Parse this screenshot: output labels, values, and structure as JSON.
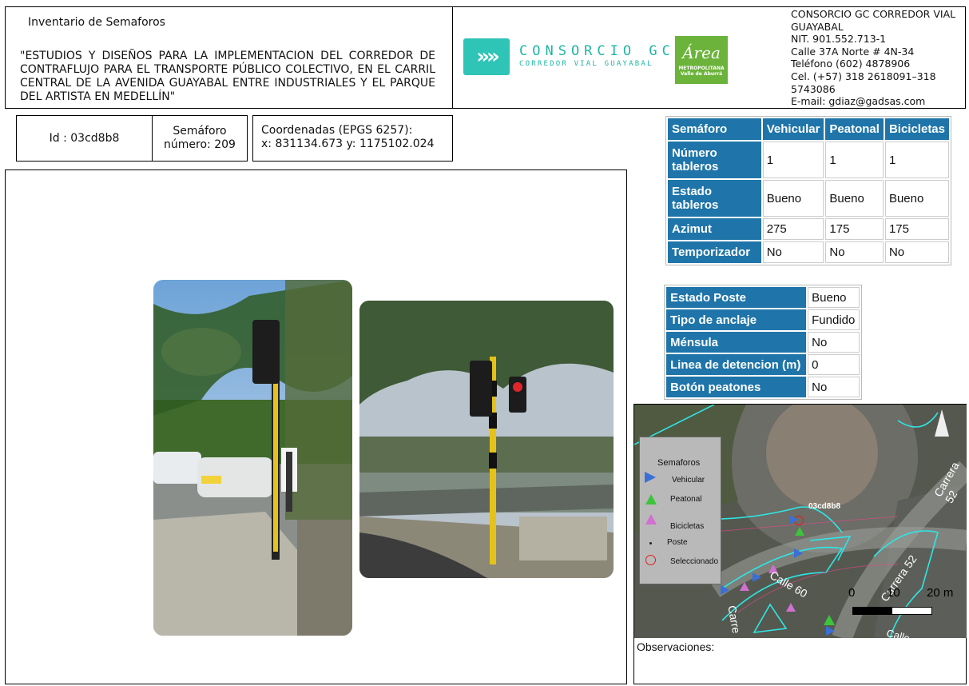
{
  "header": {
    "title": "Inventario de Semaforos",
    "description": "\"ESTUDIOS Y DISEÑOS PARA LA IMPLEMENTACION DEL CORREDOR DE CONTRAFLUJO PARA EL TRANSPORTE PÚBLICO COLECTIVO, EN EL CARRIL CENTRAL DE LA AVENIDA GUAYABAL ENTRE INDUSTRIALES Y EL PARQUE DEL ARTISTA EN MEDELLÍN\"",
    "logo_main": "CONSORCIO GC",
    "logo_sub": "CORREDOR VIAL GUAYABAL",
    "logo_area": "Área",
    "logo_area_sub": "METROPOLITANA Valle de Aburrá",
    "company": [
      "CONSORCIO GC CORREDOR VIAL",
      "GUAYABAL",
      "NIT. 901.552.713-1",
      "Calle 37A Norte # 4N-34",
      "Teléfono (602) 4878906",
      "Cel. (+57) 318 2618091–318",
      "5743086",
      "E-mail: gdiaz@gadsas.com"
    ]
  },
  "id_row": {
    "id": "Id : 03cd8b8",
    "semaforo_label": "Semáforo",
    "semaforo_num": "número: 209",
    "coord_label": "Coordenadas (EPGS 6257):",
    "coord_values": "x: 831134.673  y:  1175102.024"
  },
  "table1": {
    "headers": [
      "Semáforo",
      "Vehicular",
      "Peatonal",
      "Bicicletas"
    ],
    "rows": [
      {
        "label": "Número tableros",
        "values": [
          "1",
          "1",
          "1"
        ]
      },
      {
        "label": "Estado tableros",
        "values": [
          "Bueno",
          "Bueno",
          "Bueno"
        ]
      },
      {
        "label": "Azimut",
        "values": [
          "275",
          "175",
          "175"
        ]
      },
      {
        "label": "Temporizador",
        "values": [
          "No",
          "No",
          "No"
        ]
      }
    ]
  },
  "table2": [
    {
      "label": "Estado Poste",
      "value": "Bueno"
    },
    {
      "label": "Tipo de anclaje",
      "value": "Fundido"
    },
    {
      "label": "Ménsula",
      "value": "No"
    },
    {
      "label": "Linea de detencion (m)",
      "value": "0"
    },
    {
      "label": "Botón peatones",
      "value": "No"
    }
  ],
  "map": {
    "legend_title": "Semaforos",
    "legend_items": [
      "Vehicular",
      "Peatonal",
      "Bicicletas",
      "Poste",
      "Seleccionado"
    ],
    "selected_label": "03cd8b8",
    "street_labels": [
      "Carrera 52",
      "Carrera 52",
      "Calle 60",
      "Carre",
      "Calle"
    ],
    "scale": [
      "0",
      "10",
      "20 m"
    ],
    "colors": {
      "vehicular": "#3a6fd8",
      "peatonal": "#3cc43c",
      "bicicletas": "#d070d0",
      "seleccionado": "#e02020",
      "lines": "#2ee6e6"
    }
  },
  "observaciones": "Observaciones:"
}
